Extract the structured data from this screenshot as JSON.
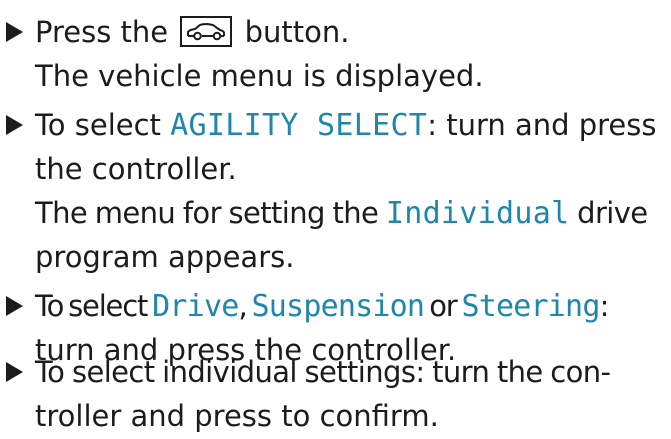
{
  "steps": [
    {
      "lines": [
        {
          "pre": "Press the",
          "icon": "car-vehicle-icon",
          "post": "button."
        },
        {
          "text": "The vehicle menu is displayed."
        }
      ]
    },
    {
      "lines": [
        {
          "pre": "To select",
          "term": "AGILITY SELECT",
          "post": ": turn and press"
        },
        {
          "text": "the controller."
        },
        {
          "pre": "The menu for setting the",
          "term": "Individual",
          "post": "drive"
        },
        {
          "text": "program appears."
        }
      ]
    },
    {
      "lines": [
        {
          "pre": "To select",
          "term1": "Drive",
          "sep1": ",",
          "term2": "Suspension",
          "sep2": "or",
          "term3": "Steering",
          "post": ":"
        },
        {
          "text": "turn and press the controller."
        }
      ]
    },
    {
      "lines": [
        {
          "text": "To select individual settings: turn the con-"
        },
        {
          "text": "troller and press to confirm."
        }
      ]
    }
  ]
}
